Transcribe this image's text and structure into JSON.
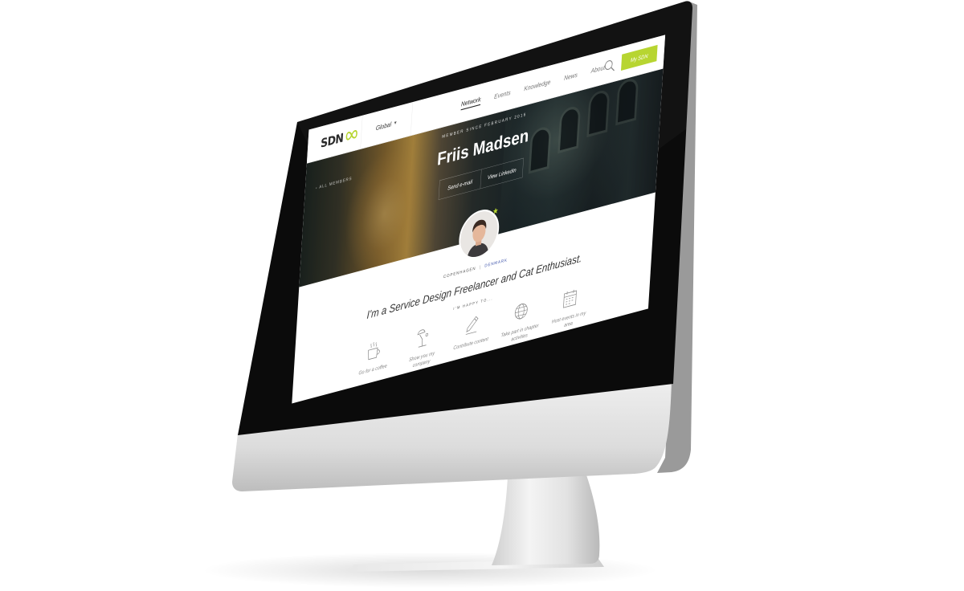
{
  "nav": {
    "logo_text": "SDN",
    "region": "Global",
    "items": [
      {
        "label": "Network",
        "active": true
      },
      {
        "label": "Events",
        "active": false
      },
      {
        "label": "Knowledge",
        "active": false
      },
      {
        "label": "News",
        "active": false
      },
      {
        "label": "About",
        "active": false
      }
    ],
    "cta_label": "My SDN"
  },
  "hero": {
    "back_label": "‹ ALL MEMBERS",
    "member_since": "MEMBER SINCE FEBRUARY 2016",
    "name": "Friis Madsen",
    "send_email_label": "Send e-mail",
    "linkedin_label": "View LinkedIn"
  },
  "profile": {
    "city": "COPENHAGEN",
    "separator": "|",
    "country": "DENMARK",
    "tagline": "I'm a Service Design Freelancer and Cat Enthusiast.",
    "happy_to_label": "I'M HAPPY TO..."
  },
  "actions": [
    {
      "icon": "coffee-cup-icon",
      "label": "Go for a coffee"
    },
    {
      "icon": "desk-lamp-icon",
      "label": "Show you my company"
    },
    {
      "icon": "pencil-icon",
      "label": "Contribute content"
    },
    {
      "icon": "globe-icon",
      "label": "Take part in chapter activities"
    },
    {
      "icon": "calendar-icon",
      "label": "Host events in my area"
    }
  ],
  "colors": {
    "accent_green": "#b7d531",
    "country_blue": "#3a4fa8",
    "bezel_black": "#0b0b0b",
    "aluminum": "#d6d6d6"
  }
}
